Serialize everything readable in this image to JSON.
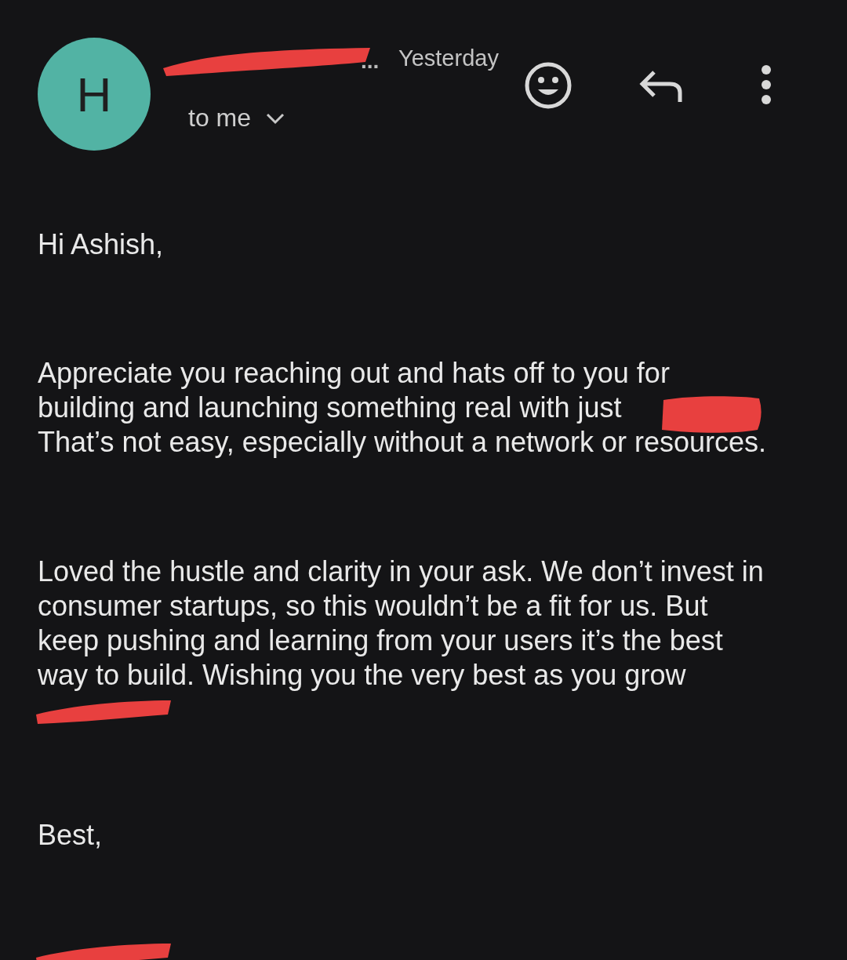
{
  "header": {
    "avatar": {
      "initial": "H",
      "color": "#52b3a4"
    },
    "sender_tail": "...",
    "time": "Yesterday",
    "recipient": "to me",
    "recipient_expanded": false
  },
  "body": [
    {
      "kind": "text",
      "lines": [
        "Hi Ashish,"
      ]
    },
    {
      "kind": "text",
      "lines": [
        "Appreciate you reaching out and hats off to you for",
        "building and launching something real with just",
        "That’s not easy, especially without a network or resources."
      ]
    },
    {
      "kind": "text",
      "lines": [
        "Loved the hustle and clarity in your ask. We don’t invest in",
        "consumer startups, so this wouldn’t be a fit for us. But",
        "keep pushing and learning from your users it’s the best",
        "way to build. Wishing you the very best as you grow"
      ]
    },
    {
      "kind": "redacted"
    },
    {
      "kind": "text",
      "lines": [
        "Best,"
      ]
    },
    {
      "kind": "redacted"
    }
  ]
}
